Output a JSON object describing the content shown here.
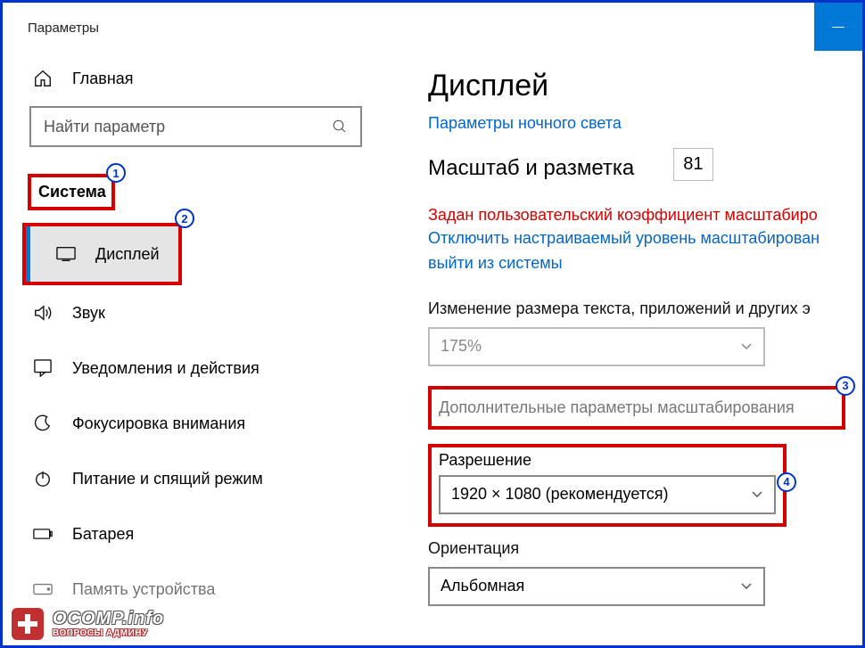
{
  "window": {
    "title": "Параметры"
  },
  "sidebar": {
    "home": "Главная",
    "search_placeholder": "Найти параметр",
    "section": "Система",
    "items": [
      {
        "label": "Дисплей"
      },
      {
        "label": "Звук"
      },
      {
        "label": "Уведомления и действия"
      },
      {
        "label": "Фокусировка внимания"
      },
      {
        "label": "Питание и спящий режим"
      },
      {
        "label": "Батарея"
      },
      {
        "label": "Память устройства"
      }
    ]
  },
  "main": {
    "title": "Дисплей",
    "night_link": "Параметры ночного света",
    "scale_heading": "Масштаб и разметка",
    "scale_value": "81",
    "warn_text": "Задан пользовательский коэффициент масштабиро",
    "link_line1": "Отключить настраиваемый уровень масштабирован",
    "link_line2": "выйти из системы",
    "resize_label": "Изменение размера текста, приложений и других э",
    "scale_select": "175%",
    "adv_link": "Дополнительные параметры масштабирования",
    "res_label": "Разрешение",
    "res_select": "1920 × 1080 (рекомендуется)",
    "orient_label": "Ориентация",
    "orient_select": "Альбомная"
  },
  "watermark": {
    "line1": "OCOMP.info",
    "line2": "ВОПРОСЫ АДМИНУ"
  },
  "callouts": {
    "c1": "1",
    "c2": "2",
    "c3": "3",
    "c4": "4"
  }
}
